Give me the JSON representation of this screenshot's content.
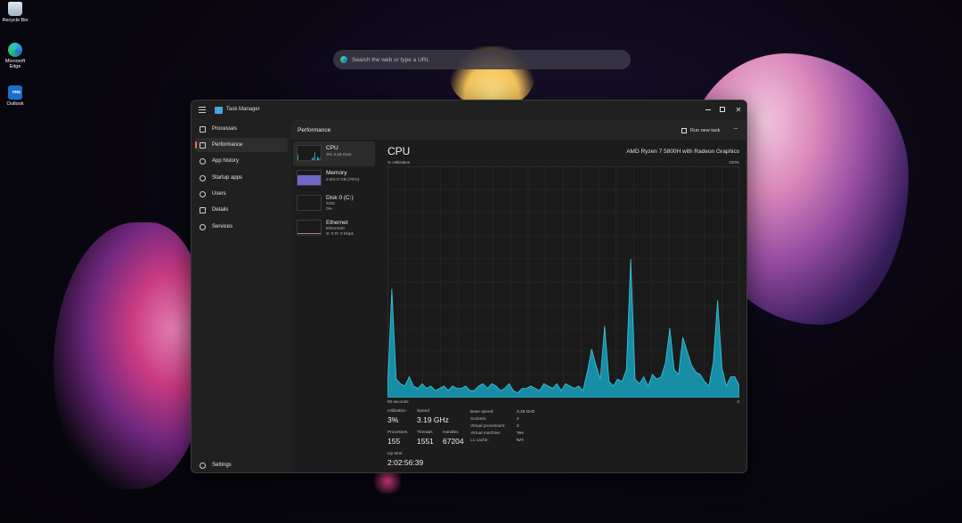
{
  "desktop": {
    "icons": [
      {
        "label": "Recycle Bin",
        "icon": "recycle-bin-icon"
      },
      {
        "label": "Microsoft Edge",
        "icon": "edge-icon"
      },
      {
        "label": "Outlook",
        "icon": "outlook-icon",
        "badge": "PRE"
      }
    ]
  },
  "search": {
    "placeholder": "Search the web or type a URL"
  },
  "window": {
    "title": "Task Manager",
    "nav": [
      {
        "label": "Processes",
        "icon": "processes-icon"
      },
      {
        "label": "Performance",
        "icon": "performance-icon",
        "active": true
      },
      {
        "label": "App history",
        "icon": "app-history-icon"
      },
      {
        "label": "Startup apps",
        "icon": "startup-apps-icon"
      },
      {
        "label": "Users",
        "icon": "users-icon"
      },
      {
        "label": "Details",
        "icon": "details-icon"
      },
      {
        "label": "Services",
        "icon": "services-icon"
      }
    ],
    "settings_label": "Settings",
    "accent": "#e8704c"
  },
  "performance": {
    "page_title": "Performance",
    "run_new_task": "Run new task",
    "resources": [
      {
        "name": "CPU",
        "lines": [
          "3% 3.19 GHz"
        ],
        "color": "#17a2c0"
      },
      {
        "name": "Memory",
        "lines": [
          "2.8/4.0 GB (70%)"
        ],
        "color": "#8a7fd8"
      },
      {
        "name": "Disk 0 (C:)",
        "lines": [
          "SSD",
          "0%"
        ],
        "color": "#6fbf3f"
      },
      {
        "name": "Ethernet",
        "lines": [
          "Ethernet0",
          "S: 0 R: 0 Kbps"
        ],
        "color": "#d07aa0"
      }
    ],
    "cpu": {
      "title": "CPU",
      "model": "AMD Ryzen 7 5800H with Radeon Graphics",
      "y_label": "% Utilization",
      "y_max_label": "100%",
      "x_left_label": "60 seconds",
      "x_right_label": "0",
      "stats": {
        "utilization_label": "Utilization",
        "utilization": "3%",
        "speed_label": "Speed",
        "speed": "3.19 GHz",
        "processes_label": "Processes",
        "processes": "155",
        "threads_label": "Threads",
        "threads": "1551",
        "handles_label": "Handles",
        "handles": "67204",
        "uptime_label": "Up time",
        "uptime": "2:02:56:39"
      },
      "specs": [
        {
          "k": "Base speed:",
          "v": "3.19 GHz"
        },
        {
          "k": "Sockets:",
          "v": "2"
        },
        {
          "k": "Virtual processors:",
          "v": "2"
        },
        {
          "k": "Virtual machine:",
          "v": "Yes"
        },
        {
          "k": "L1 cache:",
          "v": "N/A"
        }
      ]
    },
    "chart_data": {
      "type": "area",
      "ylim": [
        0,
        100
      ],
      "x_label_left": "60 seconds",
      "x_label_right": "0",
      "values": [
        3,
        47,
        8,
        6,
        5,
        9,
        5,
        4,
        6,
        4,
        5,
        3,
        4,
        5,
        3,
        5,
        4,
        4,
        5,
        3,
        3,
        5,
        6,
        4,
        6,
        5,
        3,
        4,
        6,
        3,
        2,
        4,
        4,
        5,
        4,
        3,
        6,
        5,
        4,
        6,
        3,
        6,
        5,
        4,
        5,
        3,
        11,
        21,
        14,
        8,
        31,
        7,
        5,
        8,
        7,
        12,
        60,
        8,
        6,
        9,
        5,
        10,
        8,
        9,
        15,
        30,
        12,
        10,
        26,
        20,
        14,
        11,
        10,
        7,
        5,
        15,
        42,
        13,
        5,
        9,
        9,
        5
      ],
      "color": "#17a2c0"
    }
  }
}
